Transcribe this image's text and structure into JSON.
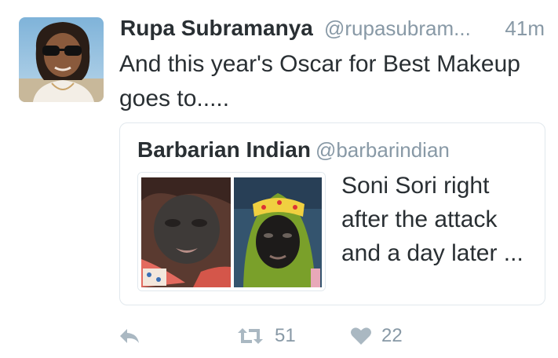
{
  "tweet": {
    "author_name": "Rupa Subramanya",
    "author_handle": "@rupasubram...",
    "timestamp": "41m",
    "text_line1": "And this year's Oscar for Best Makeup",
    "text_line2": "goes to.....",
    "avatar_icon": "user-avatar-photo"
  },
  "quoted_tweet": {
    "author_name": "Barbarian Indian",
    "author_handle": "@barbarindian",
    "text_line1": "Soni Sori right",
    "text_line2": "after the attack",
    "text_line3": "and a day later ...",
    "media_icon": "photo-collage"
  },
  "actions": {
    "reply_icon": "reply-icon",
    "retweet_icon": "retweet-icon",
    "retweet_count": "51",
    "like_icon": "heart-icon",
    "like_count": "22"
  },
  "colors": {
    "text": "#292f33",
    "secondary": "#8899a6",
    "icon": "#aab8c2",
    "border": "#e1e8ed"
  }
}
